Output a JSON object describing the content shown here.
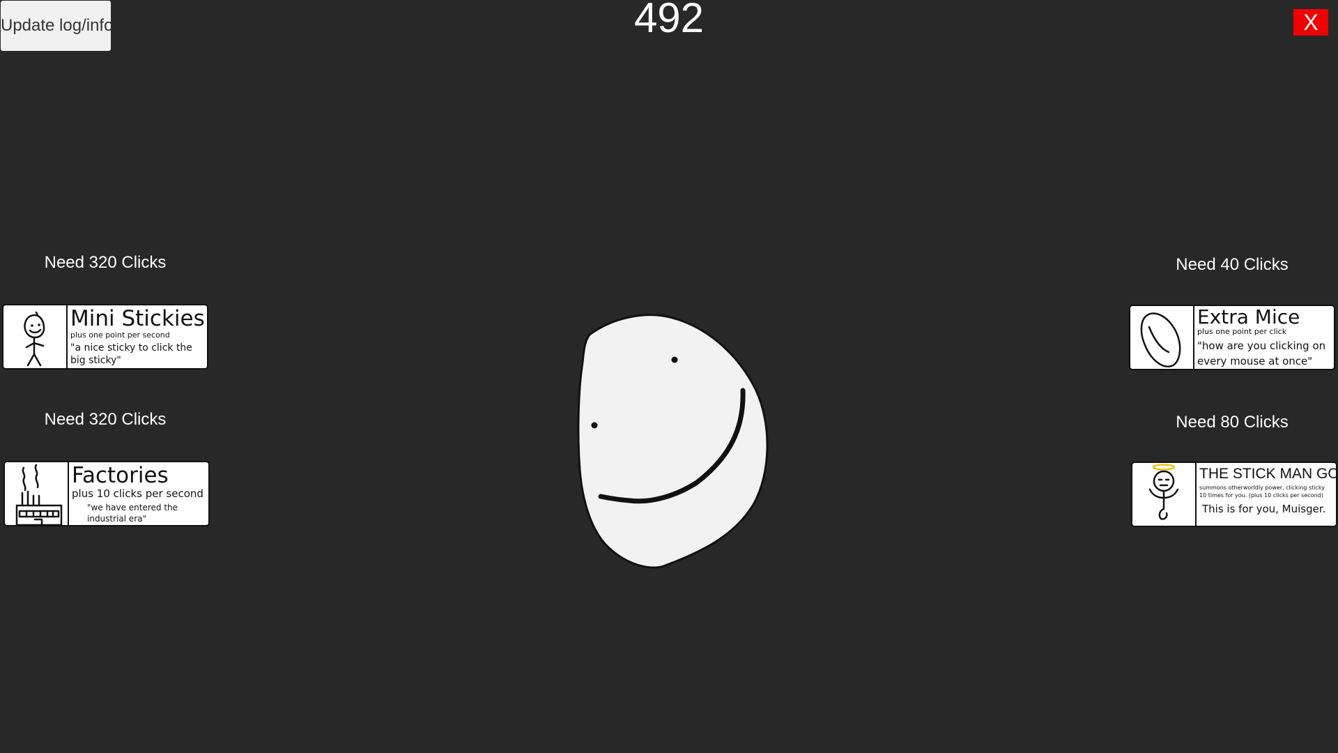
{
  "header": {
    "update_button_label": "Update log/info",
    "score": "492",
    "close_label": "X"
  },
  "upgrades": {
    "mini_stickies": {
      "need": "Need 320 Clicks",
      "title": "Mini Stickies",
      "subtitle": "plus one point per second",
      "quote": "\"a nice sticky to click the big sticky\""
    },
    "factories": {
      "need": "Need 320 Clicks",
      "title": "Factories",
      "subtitle": "plus 10 clicks per second",
      "quote": "\"we have entered the industrial era\""
    },
    "extra_mice": {
      "need": "Need 40 Clicks",
      "title": "Extra Mice",
      "subtitle": "plus one point per click",
      "quote": "\"how are you clicking on every mouse at once\""
    },
    "stick_man_god": {
      "need": "Need 80 Clicks",
      "title": "THE STICK MAN GOD",
      "subtitle": "summons otherworldly power, clicking sticky 10 times for you. (plus 10 clicks per second)",
      "quote": "This is for you, Muisger."
    }
  },
  "colors": {
    "background": "#282828",
    "close_button": "#ef0000",
    "sticky_fill": "#f2f2f2"
  }
}
